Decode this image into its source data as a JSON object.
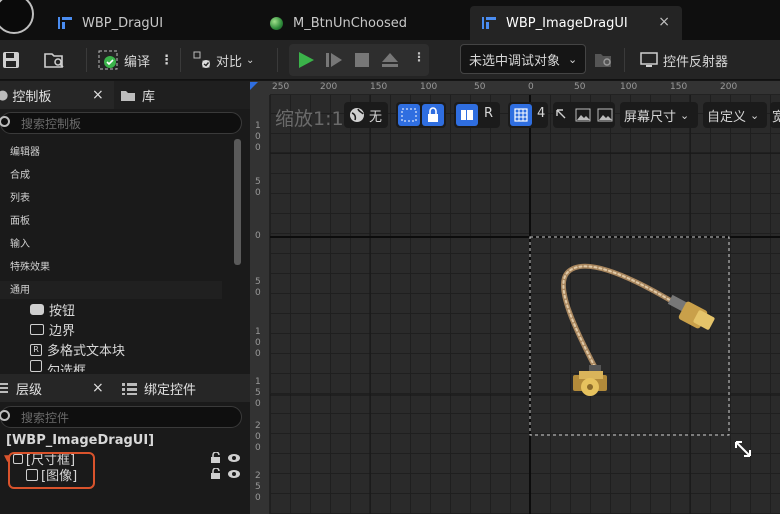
{
  "tabs": [
    {
      "label": "WBP_DragUI",
      "icon": "widget-blueprint-icon",
      "active": false
    },
    {
      "label": "M_BtnUnChoosed",
      "icon": "material-icon",
      "active": false
    },
    {
      "label": "WBP_ImageDragUI",
      "icon": "widget-blueprint-icon",
      "active": true,
      "close": "×"
    }
  ],
  "toolbar": {
    "compile_label": "编译",
    "diff_label": "对比",
    "debug_target": "未选中调试对象",
    "widget_reflector": "控件反射器"
  },
  "palette": {
    "title": "控制板",
    "library_tab": "库",
    "close": "×",
    "search_placeholder": "搜索控制板",
    "categories": [
      "编辑器",
      "合成",
      "列表",
      "面板",
      "输入",
      "特殊效果",
      "通用"
    ],
    "items": [
      "按钮",
      "边界",
      "多格式文本块",
      "勾选框"
    ]
  },
  "hierarchy": {
    "title": "层级",
    "close": "×",
    "bind_tab": "绑定控件",
    "search_placeholder": "搜索控件",
    "root": "[WBP_ImageDragUI]",
    "nodes": [
      "[尺寸框]",
      "[图像]"
    ]
  },
  "designer": {
    "zoom_label": "缩放1:1",
    "view_none": "无",
    "view_r": "R",
    "grid_size": "4",
    "screen_size": "屏幕尺寸",
    "custom": "自定义",
    "width_cut": "宽",
    "ruler_top": [
      "250",
      "200",
      "150",
      "100",
      "50",
      "0",
      "50",
      "100",
      "150",
      "200"
    ],
    "ruler_left": [
      "1\n0\n0",
      "5\n0",
      "0",
      "5\n0",
      "1\n0\n0",
      "1\n5\n0",
      "2\n0\n0",
      "2\n5\n0"
    ]
  },
  "colors": {
    "accent_blue": "#2f6ee0",
    "play_green": "#3bb34a",
    "highlight_red": "#d9532c"
  }
}
